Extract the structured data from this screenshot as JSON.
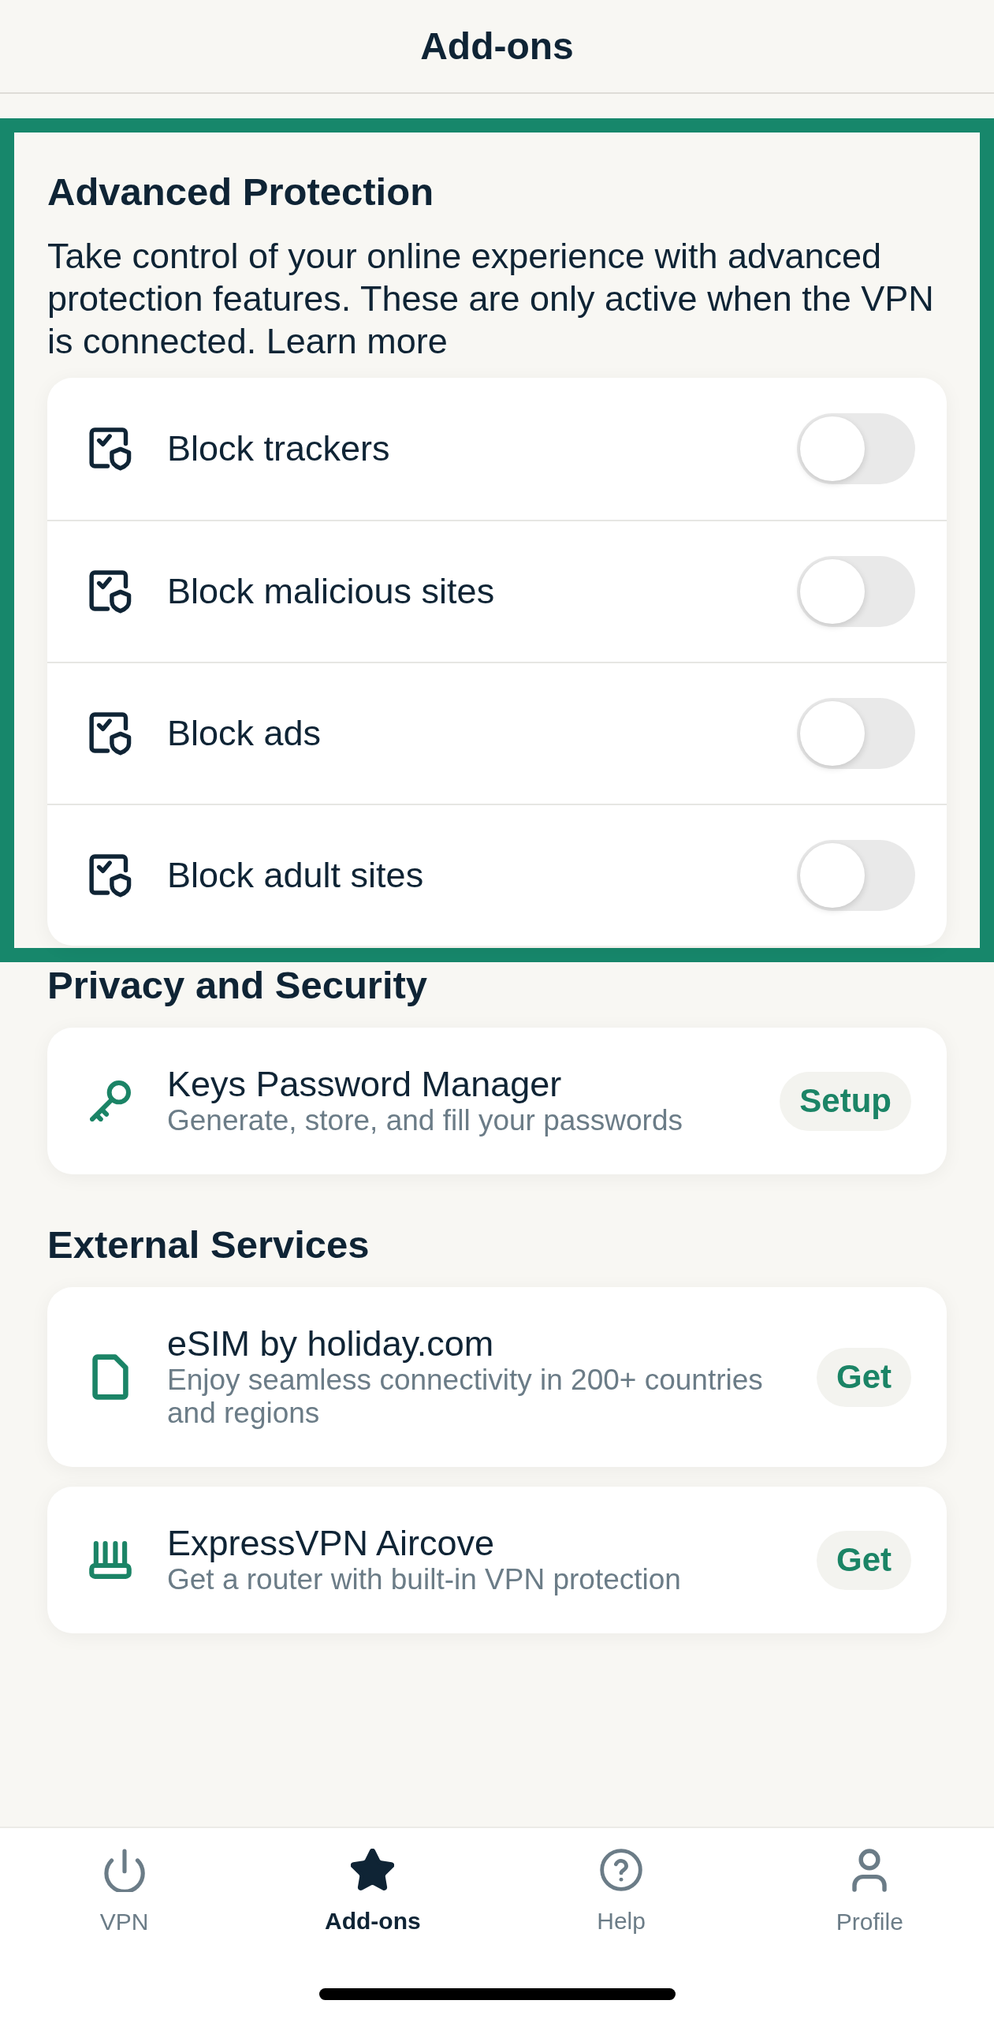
{
  "header": {
    "title": "Add-ons"
  },
  "advanced_protection": {
    "title": "Advanced Protection",
    "description": "Take control of your online experience with advanced protection features. These are only active when the VPN is connected. Learn more",
    "toggles": [
      {
        "label": "Block trackers",
        "on": false
      },
      {
        "label": "Block malicious sites",
        "on": false
      },
      {
        "label": "Block ads",
        "on": false
      },
      {
        "label": "Block adult sites",
        "on": false
      }
    ]
  },
  "privacy_and_security": {
    "title": "Privacy and Security",
    "items": [
      {
        "title": "Keys Password Manager",
        "subtitle": "Generate, store, and fill your passwords",
        "action": "Setup"
      }
    ]
  },
  "external_services": {
    "title": "External Services",
    "items": [
      {
        "title": "eSIM by holiday.com",
        "subtitle": "Enjoy seamless connectivity in 200+ countries and regions",
        "action": "Get"
      },
      {
        "title": "ExpressVPN Aircove",
        "subtitle": "Get a router with built-in VPN protection",
        "action": "Get"
      }
    ]
  },
  "tab_bar": [
    {
      "label": "VPN",
      "selected": false
    },
    {
      "label": "Add-ons",
      "selected": true
    },
    {
      "label": "Help",
      "selected": false
    },
    {
      "label": "Profile",
      "selected": false
    }
  ]
}
